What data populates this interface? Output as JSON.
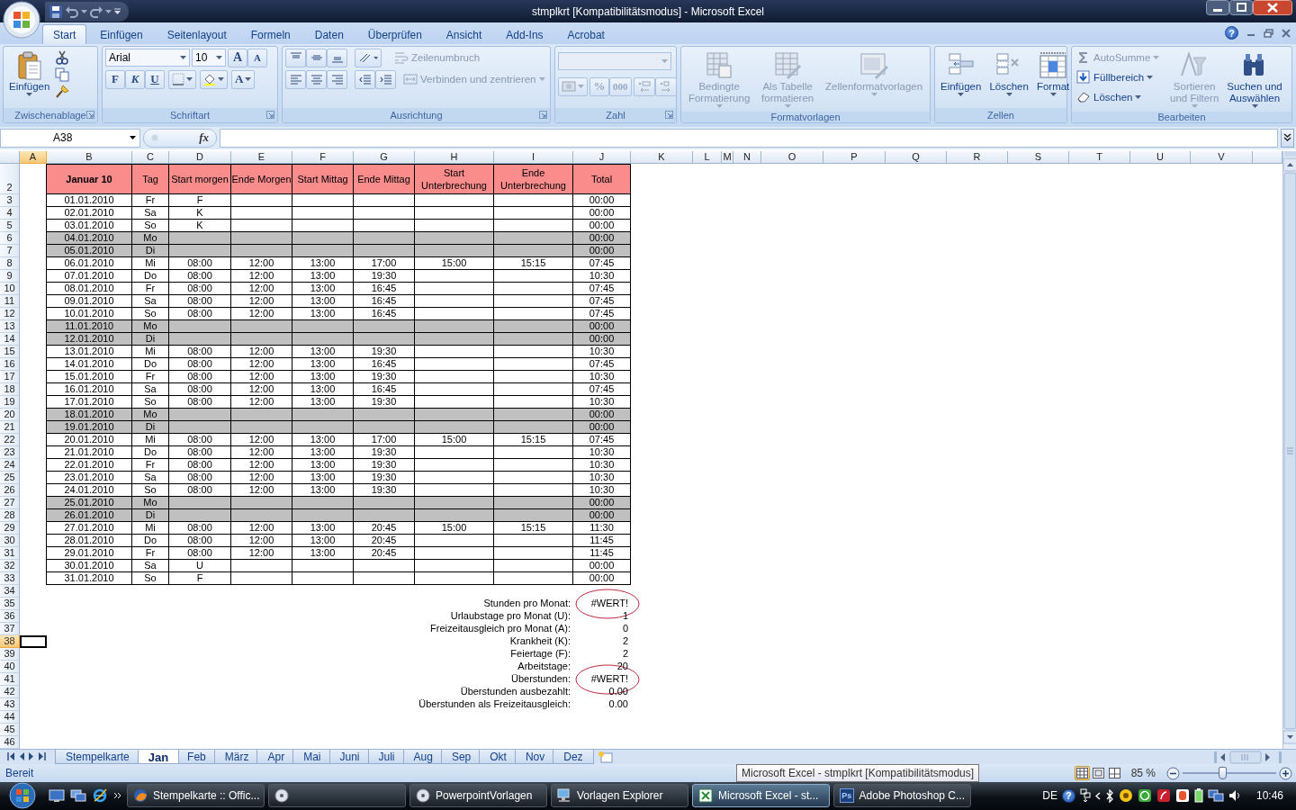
{
  "window": {
    "title": "stmplkrt  [Kompatibilitätsmodus] - Microsoft Excel"
  },
  "ribbon": {
    "tabs": [
      {
        "label": "Start",
        "selected": true
      },
      {
        "label": "Einfügen",
        "selected": false
      },
      {
        "label": "Seitenlayout",
        "selected": false
      },
      {
        "label": "Formeln",
        "selected": false
      },
      {
        "label": "Daten",
        "selected": false
      },
      {
        "label": "Überprüfen",
        "selected": false
      },
      {
        "label": "Ansicht",
        "selected": false
      },
      {
        "label": "Add-Ins",
        "selected": false
      },
      {
        "label": "Acrobat",
        "selected": false
      }
    ],
    "help_label": "?",
    "groups": [
      {
        "kind": "clipboard",
        "label": "Zwischenablage",
        "launcher": true,
        "paste": "Einfügen"
      },
      {
        "kind": "font",
        "label": "Schriftart",
        "launcher": true,
        "font": "Arial",
        "size": "10",
        "grow": "A",
        "shrink": "A",
        "bold": "F",
        "italic": "K",
        "underline": "U",
        "font_color": "A"
      },
      {
        "kind": "alignment",
        "label": "Ausrichtung",
        "launcher": true,
        "wrap": {
          "label": "Zeilenumbruch",
          "disabled": true
        },
        "merge": {
          "label": "Verbinden und zentrieren",
          "disabled": true
        }
      },
      {
        "kind": "number",
        "label": "Zahl",
        "launcher": true,
        "disabled": true,
        "percent": "%",
        "thousands": "000"
      },
      {
        "kind": "styles",
        "label": "Formatvorlagen",
        "buttons": [
          {
            "label": "Bedingte\nFormatierung",
            "disabled": true,
            "dropdown": true
          },
          {
            "label": "Als Tabelle\nformatieren",
            "disabled": true,
            "dropdown": true
          },
          {
            "label": "Zellenformatvorlagen",
            "disabled": true,
            "dropdown": true
          }
        ]
      },
      {
        "kind": "cells",
        "label": "Zellen",
        "buttons": [
          {
            "label": "Einfügen",
            "disabled": false,
            "dropdown": true
          },
          {
            "label": "Löschen",
            "disabled": false,
            "dropdown": true
          },
          {
            "label": "Format",
            "disabled": false,
            "dropdown": true
          }
        ]
      },
      {
        "kind": "editing",
        "label": "Bearbeiten",
        "small": [
          {
            "label": "AutoSumme",
            "disabled": true
          },
          {
            "label": "Füllbereich",
            "disabled": false
          },
          {
            "label": "Löschen",
            "disabled": false
          }
        ],
        "buttons": [
          {
            "label": "Sortieren\nund Filtern",
            "disabled": true,
            "dropdown": true
          },
          {
            "label": "Suchen und\nAuswählen",
            "disabled": false,
            "dropdown": true
          }
        ]
      }
    ]
  },
  "formula_bar": {
    "name_box": "A38",
    "function_label": "fx"
  },
  "sheet": {
    "columns": [
      {
        "label": "A",
        "selected": true
      },
      {
        "label": "B",
        "selected": false
      },
      {
        "label": "C",
        "selected": false
      },
      {
        "label": "D",
        "selected": false
      },
      {
        "label": "E",
        "selected": false
      },
      {
        "label": "F",
        "selected": false
      },
      {
        "label": "G",
        "selected": false
      },
      {
        "label": "H",
        "selected": false
      },
      {
        "label": "I",
        "selected": false
      },
      {
        "label": "J",
        "selected": false
      },
      {
        "label": "K",
        "selected": false
      },
      {
        "label": "L",
        "selected": false
      },
      {
        "label": "M",
        "selected": false
      },
      {
        "label": "N",
        "selected": false
      },
      {
        "label": "O",
        "selected": false
      },
      {
        "label": "P",
        "selected": false
      },
      {
        "label": "Q",
        "selected": false
      },
      {
        "label": "R",
        "selected": false
      },
      {
        "label": "S",
        "selected": false
      },
      {
        "label": "T",
        "selected": false
      },
      {
        "label": "U",
        "selected": false
      },
      {
        "label": "V",
        "selected": false
      }
    ],
    "header_row": {
      "number": "2",
      "labels": [
        "Januar 10",
        "Tag",
        "Start morgen",
        "Ende Morgen",
        "Start Mittag",
        "Ende Mittag",
        "Start\nUnterbrechung",
        "Ende\nUnterbrechung",
        "Total"
      ]
    },
    "rows": [
      {
        "number": "3",
        "shaded": false,
        "date": "01.01.2010",
        "day": "Fr",
        "start_morning": "F",
        "total": "00:00"
      },
      {
        "number": "4",
        "shaded": false,
        "date": "02.01.2010",
        "day": "Sa",
        "start_morning": "K",
        "total": "00:00"
      },
      {
        "number": "5",
        "shaded": false,
        "date": "03.01.2010",
        "day": "So",
        "start_morning": "K",
        "total": "00:00"
      },
      {
        "number": "6",
        "shaded": true,
        "date": "04.01.2010",
        "day": "Mo",
        "total": "00:00"
      },
      {
        "number": "7",
        "shaded": true,
        "date": "05.01.2010",
        "day": "Di",
        "total": "00:00"
      },
      {
        "number": "8",
        "shaded": false,
        "date": "06.01.2010",
        "day": "Mi",
        "start_morning": "08:00",
        "end_morning": "12:00",
        "start_noon": "13:00",
        "end_noon": "17:00",
        "break_start": "15:00",
        "break_end": "15:15",
        "total": "07:45"
      },
      {
        "number": "9",
        "shaded": false,
        "date": "07.01.2010",
        "day": "Do",
        "start_morning": "08:00",
        "end_morning": "12:00",
        "start_noon": "13:00",
        "end_noon": "19:30",
        "total": "10:30"
      },
      {
        "number": "10",
        "shaded": false,
        "date": "08.01.2010",
        "day": "Fr",
        "start_morning": "08:00",
        "end_morning": "12:00",
        "start_noon": "13:00",
        "end_noon": "16:45",
        "total": "07:45"
      },
      {
        "number": "11",
        "shaded": false,
        "date": "09.01.2010",
        "day": "Sa",
        "start_morning": "08:00",
        "end_morning": "12:00",
        "start_noon": "13:00",
        "end_noon": "16:45",
        "total": "07:45"
      },
      {
        "number": "12",
        "shaded": false,
        "date": "10.01.2010",
        "day": "So",
        "start_morning": "08:00",
        "end_morning": "12:00",
        "start_noon": "13:00",
        "end_noon": "16:45",
        "total": "07:45"
      },
      {
        "number": "13",
        "shaded": true,
        "date": "11.01.2010",
        "day": "Mo",
        "total": "00:00"
      },
      {
        "number": "14",
        "shaded": true,
        "date": "12.01.2010",
        "day": "Di",
        "total": "00:00"
      },
      {
        "number": "15",
        "shaded": false,
        "date": "13.01.2010",
        "day": "Mi",
        "start_morning": "08:00",
        "end_morning": "12:00",
        "start_noon": "13:00",
        "end_noon": "19:30",
        "total": "10:30"
      },
      {
        "number": "16",
        "shaded": false,
        "date": "14.01.2010",
        "day": "Do",
        "start_morning": "08:00",
        "end_morning": "12:00",
        "start_noon": "13:00",
        "end_noon": "16:45",
        "total": "07:45"
      },
      {
        "number": "17",
        "shaded": false,
        "date": "15.01.2010",
        "day": "Fr",
        "start_morning": "08:00",
        "end_morning": "12:00",
        "start_noon": "13:00",
        "end_noon": "19:30",
        "total": "10:30"
      },
      {
        "number": "18",
        "shaded": false,
        "date": "16.01.2010",
        "day": "Sa",
        "start_morning": "08:00",
        "end_morning": "12:00",
        "start_noon": "13:00",
        "end_noon": "16:45",
        "total": "07:45"
      },
      {
        "number": "19",
        "shaded": false,
        "date": "17.01.2010",
        "day": "So",
        "start_morning": "08:00",
        "end_morning": "12:00",
        "start_noon": "13:00",
        "end_noon": "19:30",
        "total": "10:30"
      },
      {
        "number": "20",
        "shaded": true,
        "date": "18.01.2010",
        "day": "Mo",
        "total": "00:00"
      },
      {
        "number": "21",
        "shaded": true,
        "date": "19.01.2010",
        "day": "Di",
        "total": "00:00"
      },
      {
        "number": "22",
        "shaded": false,
        "date": "20.01.2010",
        "day": "Mi",
        "start_morning": "08:00",
        "end_morning": "12:00",
        "start_noon": "13:00",
        "end_noon": "17:00",
        "break_start": "15:00",
        "break_end": "15:15",
        "total": "07:45"
      },
      {
        "number": "23",
        "shaded": false,
        "date": "21.01.2010",
        "day": "Do",
        "start_morning": "08:00",
        "end_morning": "12:00",
        "start_noon": "13:00",
        "end_noon": "19:30",
        "total": "10:30"
      },
      {
        "number": "24",
        "shaded": false,
        "date": "22.01.2010",
        "day": "Fr",
        "start_morning": "08:00",
        "end_morning": "12:00",
        "start_noon": "13:00",
        "end_noon": "19:30",
        "total": "10:30"
      },
      {
        "number": "25",
        "shaded": false,
        "date": "23.01.2010",
        "day": "Sa",
        "start_morning": "08:00",
        "end_morning": "12:00",
        "start_noon": "13:00",
        "end_noon": "19:30",
        "total": "10:30"
      },
      {
        "number": "26",
        "shaded": false,
        "date": "24.01.2010",
        "day": "So",
        "start_morning": "08:00",
        "end_morning": "12:00",
        "start_noon": "13:00",
        "end_noon": "19:30",
        "total": "10:30"
      },
      {
        "number": "27",
        "shaded": true,
        "date": "25.01.2010",
        "day": "Mo",
        "total": "00:00"
      },
      {
        "number": "28",
        "shaded": true,
        "date": "26.01.2010",
        "day": "Di",
        "total": "00:00"
      },
      {
        "number": "29",
        "shaded": false,
        "date": "27.01.2010",
        "day": "Mi",
        "start_morning": "08:00",
        "end_morning": "12:00",
        "start_noon": "13:00",
        "end_noon": "20:45",
        "break_start": "15:00",
        "break_end": "15:15",
        "total": "11:30"
      },
      {
        "number": "30",
        "shaded": false,
        "date": "28.01.2010",
        "day": "Do",
        "start_morning": "08:00",
        "end_morning": "12:00",
        "start_noon": "13:00",
        "end_noon": "20:45",
        "total": "11:45"
      },
      {
        "number": "31",
        "shaded": false,
        "date": "29.01.2010",
        "day": "Fr",
        "start_morning": "08:00",
        "end_morning": "12:00",
        "start_noon": "13:00",
        "end_noon": "20:45",
        "total": "11:45"
      },
      {
        "number": "32",
        "shaded": false,
        "date": "30.01.2010",
        "day": "Sa",
        "start_morning": "U",
        "total": "00:00"
      },
      {
        "number": "33",
        "shaded": false,
        "date": "31.01.2010",
        "day": "So",
        "start_morning": "F",
        "total": "00:00"
      }
    ],
    "spacer_rows": [
      "34"
    ],
    "summary": [
      {
        "number": "35",
        "label": "Stunden pro Monat:",
        "value": "#WERT!",
        "circled": true,
        "selected": false
      },
      {
        "number": "36",
        "label": "Urlaubstage pro Monat (U):",
        "value": "1",
        "circled": false,
        "selected": false
      },
      {
        "number": "37",
        "label": "Freizeitausgleich pro Monat (A):",
        "value": "0",
        "circled": false,
        "selected": false
      },
      {
        "number": "38",
        "label": "Krankheit (K):",
        "value": "2",
        "circled": false,
        "selected": true
      },
      {
        "number": "39",
        "label": "Feiertage (F):",
        "value": "2",
        "circled": false,
        "selected": false
      },
      {
        "number": "40",
        "label": "Arbeitstage:",
        "value": "20",
        "circled": false,
        "selected": false
      },
      {
        "number": "41",
        "label": "Überstunden:",
        "value": "#WERT!",
        "circled": true,
        "selected": false
      },
      {
        "number": "42",
        "label": "Überstunden ausbezahlt:",
        "value": "0.00",
        "circled": false,
        "selected": false
      },
      {
        "number": "43",
        "label": "Überstunden als Freizeitausgleich:",
        "value": "0.00",
        "circled": false,
        "selected": false
      }
    ],
    "trailing_rows": [
      "44",
      "45",
      "46"
    ]
  },
  "sheet_tabs": [
    {
      "label": "Stempelkarte",
      "selected": false
    },
    {
      "label": "Jan",
      "selected": true
    },
    {
      "label": "Feb",
      "selected": false
    },
    {
      "label": "März",
      "selected": false
    },
    {
      "label": "Apr",
      "selected": false
    },
    {
      "label": "Mai",
      "selected": false
    },
    {
      "label": "Juni",
      "selected": false
    },
    {
      "label": "Juli",
      "selected": false
    },
    {
      "label": "Aug",
      "selected": false
    },
    {
      "label": "Sep",
      "selected": false
    },
    {
      "label": "Okt",
      "selected": false
    },
    {
      "label": "Nov",
      "selected": false
    },
    {
      "label": "Dez",
      "selected": false
    }
  ],
  "status_bar": {
    "mode": "Bereit",
    "tooltip": "Microsoft Excel - stmplkrt  [Kompatibilitätsmodus]",
    "views": [
      {
        "kind": "normal",
        "selected": true
      },
      {
        "kind": "layout",
        "selected": false
      },
      {
        "kind": "pagebreak",
        "selected": false
      }
    ],
    "zoom": "85 %",
    "zoom_slider": {
      "level": 0.42
    }
  },
  "taskbar": {
    "items": [
      {
        "label": "Stempelkarte :: Offic...",
        "selected": false
      },
      {
        "selected": false
      },
      {
        "label": "PowerpointVorlagen",
        "selected": false
      },
      {
        "label": "Vorlagen Explorer",
        "selected": false
      },
      {
        "label": "Microsoft Excel - st...",
        "selected": true
      },
      {
        "badge": "Ps",
        "label": "Adobe Photoshop C...",
        "selected": false
      }
    ],
    "language": "DE",
    "help_label": "?",
    "clock": "10:46"
  }
}
